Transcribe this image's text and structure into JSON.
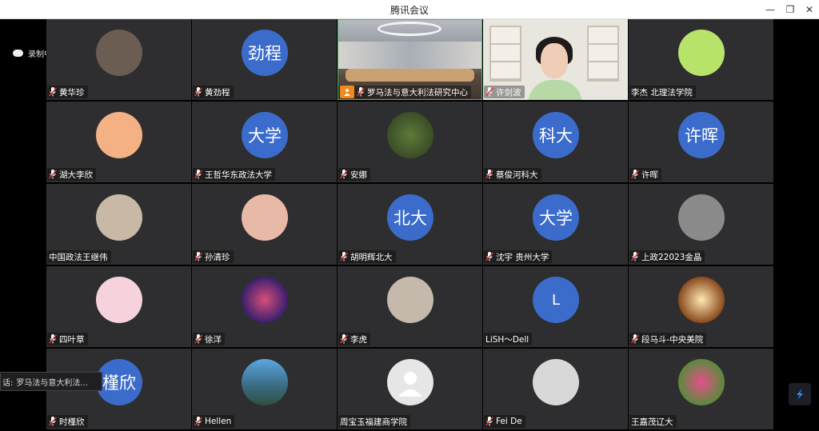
{
  "window": {
    "title": "腾讯会议",
    "minimize": "—",
    "restore": "❐",
    "close": "✕"
  },
  "recording": {
    "label": "录制中"
  },
  "toast": {
    "prefix": "话:",
    "text": "罗马法与意大利法..."
  },
  "colors": {
    "tile_bg": "#2e2e30",
    "avatar_blue": "#3b6ccc",
    "active_border": "#3bbd6a"
  },
  "participants": [
    {
      "name": "黄华珍",
      "avatar": "photo",
      "mic": true
    },
    {
      "name": "黄劲程",
      "avatar_text": "劲程",
      "mic": true
    },
    {
      "name": "罗马法与意大利法研究中心",
      "avatar": "video-room",
      "mic": true,
      "hand": true
    },
    {
      "name": "许剑波",
      "avatar": "video-person",
      "mic": true
    },
    {
      "name": "李杰 北理法学院",
      "avatar": "frog",
      "mic": false
    },
    {
      "name": "湖大李欣",
      "avatar": "puppy",
      "mic": true
    },
    {
      "name": "王哲华东政法大学",
      "avatar_text": "大学",
      "mic": true
    },
    {
      "name": "安娜",
      "avatar": "plant",
      "mic": true
    },
    {
      "name": "蔡俊河科大",
      "avatar_text": "科大",
      "mic": true
    },
    {
      "name": "许晖",
      "avatar_text": "许晖",
      "mic": true
    },
    {
      "name": "中国政法王继伟",
      "avatar": "cartoon",
      "mic": false
    },
    {
      "name": "孙清珍",
      "avatar": "glasses",
      "mic": true
    },
    {
      "name": "胡明辉北大",
      "avatar_text": "北大",
      "mic": true
    },
    {
      "name": "沈宇 贵州大学",
      "avatar_text": "大学",
      "mic": true
    },
    {
      "name": "上政22023金晶",
      "avatar": "gray",
      "mic": true
    },
    {
      "name": "四叶草",
      "avatar": "pikachu",
      "mic": true
    },
    {
      "name": "徐洋",
      "avatar": "galaxy",
      "mic": true
    },
    {
      "name": "李虎",
      "avatar": "cat",
      "mic": true
    },
    {
      "name": "LiSH～Dell",
      "avatar_text": "L",
      "mic": false
    },
    {
      "name": "段马斗-中央美院",
      "avatar": "light",
      "mic": true
    },
    {
      "name": "时槿欣",
      "avatar_text": "槿欣",
      "mic": true
    },
    {
      "name": "Hellen",
      "avatar": "sky",
      "mic": true
    },
    {
      "name": "周宝玉福建商学院",
      "avatar": "default",
      "mic": false
    },
    {
      "name": "Fei De",
      "avatar": "flowers",
      "mic": true
    },
    {
      "name": "王嘉茂辽大",
      "avatar": "pink-flower",
      "mic": false
    }
  ]
}
